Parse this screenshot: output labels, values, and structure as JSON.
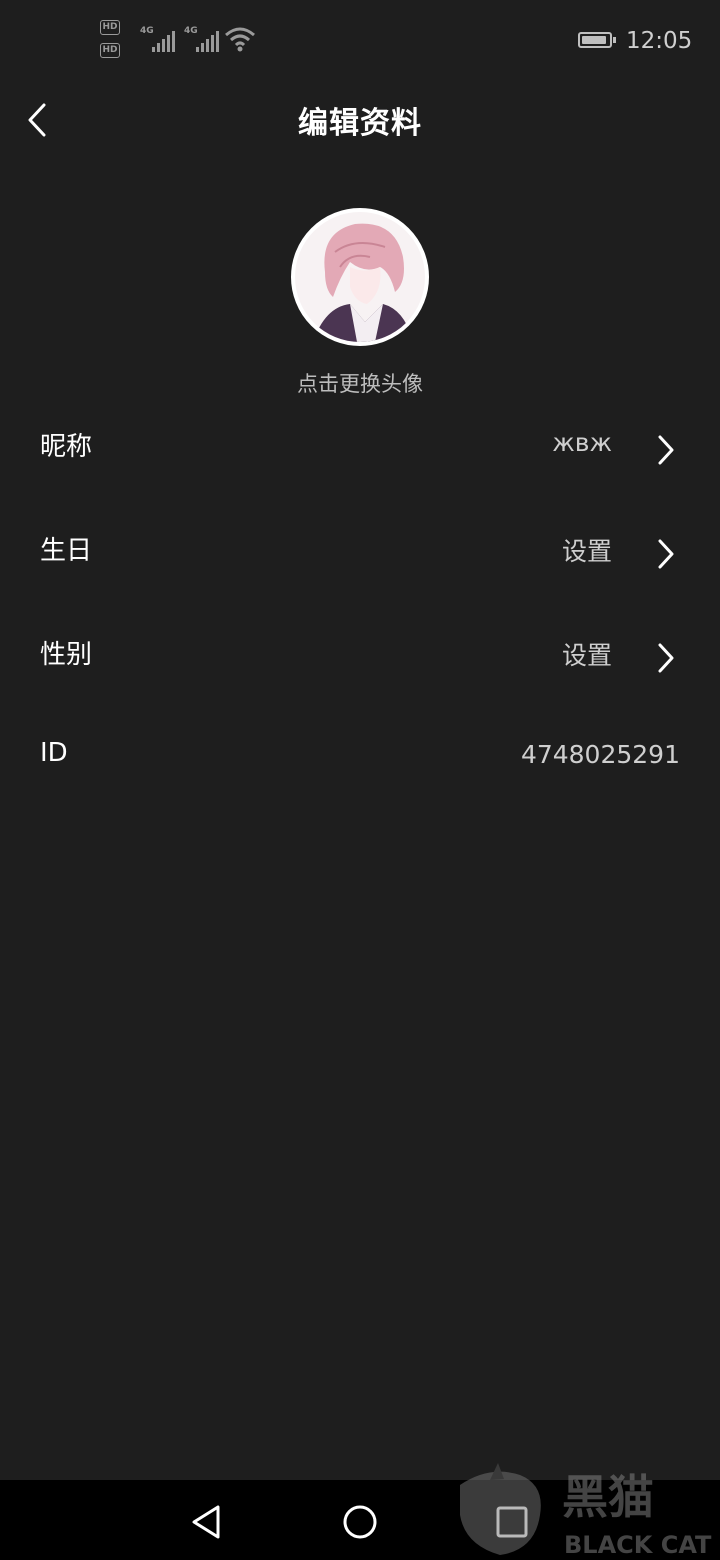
{
  "status_bar": {
    "hd1": "HD",
    "hd2": "HD",
    "sub1": "1",
    "sub2": "2",
    "net1": "4G",
    "net2": "4G",
    "time": "12:05",
    "icons": [
      "signal-icon",
      "wifi-icon",
      "battery-icon"
    ]
  },
  "header": {
    "back_icon": "chevron-left-icon",
    "title": "编辑资料"
  },
  "avatar": {
    "caption": "点击更换头像"
  },
  "fields": [
    {
      "label": "昵称",
      "value": "жвж",
      "has_arrow": true
    },
    {
      "label": "生日",
      "value": "设置",
      "has_arrow": true
    },
    {
      "label": "性别",
      "value": "设置",
      "has_arrow": true
    },
    {
      "label": "ID",
      "value": "4748025291",
      "has_arrow": false
    }
  ],
  "navbar": {
    "icons": [
      "back-triangle-icon",
      "home-circle-icon",
      "recents-square-icon"
    ]
  },
  "watermark": {
    "text_cn": "黑猫",
    "text_en": "BLACK CAT"
  },
  "colors": {
    "background": "#1e1e1e",
    "text_primary": "#ffffff",
    "text_secondary": "#cfcfcf",
    "navbar": "#000000"
  }
}
